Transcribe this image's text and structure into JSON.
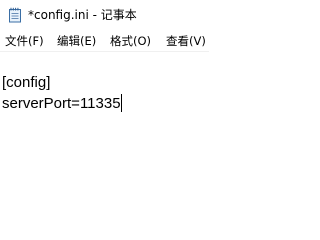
{
  "window": {
    "title": "*config.ini - 记事本",
    "icon": "notepad-icon"
  },
  "menu": {
    "file": "文件(F)",
    "edit": "编辑(E)",
    "format": "格式(O)",
    "view": "查看(V)"
  },
  "editor": {
    "lines": [
      "[config]",
      "serverPort=11335"
    ]
  }
}
